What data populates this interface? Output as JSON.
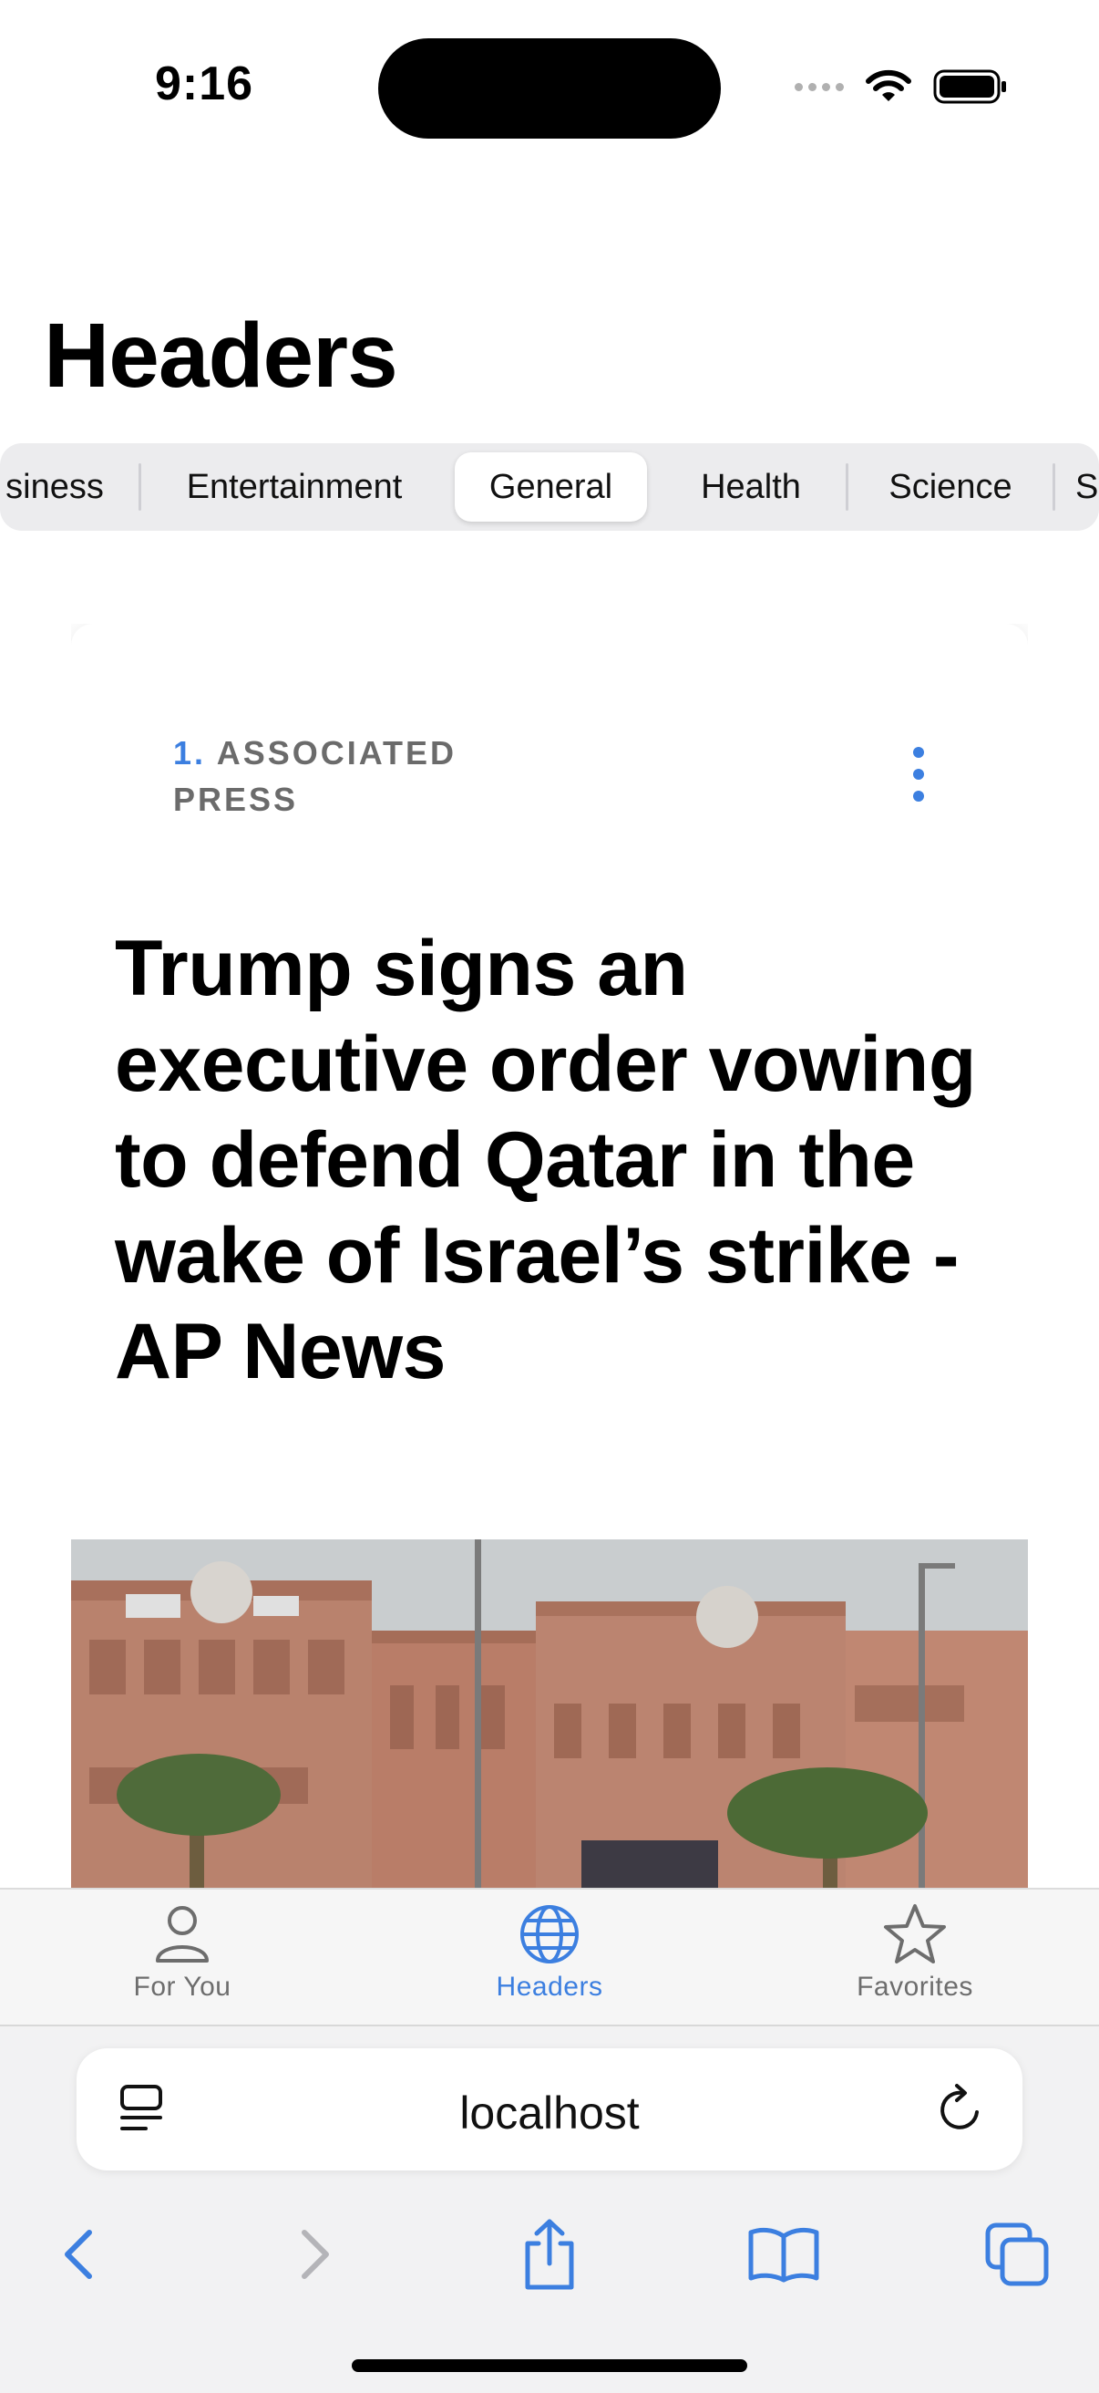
{
  "status_bar": {
    "time": "9:16"
  },
  "page_title": "Headers",
  "categories": [
    {
      "label": "siness",
      "active": false
    },
    {
      "label": "Entertainment",
      "active": false
    },
    {
      "label": "General",
      "active": true
    },
    {
      "label": "Health",
      "active": false
    },
    {
      "label": "Science",
      "active": false
    },
    {
      "label": "S",
      "active": false
    }
  ],
  "article": {
    "rank": "1.",
    "source_line1": "ASSOCIATED",
    "source_line2": "PRESS",
    "headline": "Trump signs an executive order vowing to defend Qatar in the wake of Israel’s strike - AP News"
  },
  "tab_bar": {
    "tabs": [
      {
        "label": "For You",
        "icon": "person-icon",
        "active": false
      },
      {
        "label": "Headers",
        "icon": "globe-icon",
        "active": true
      },
      {
        "label": "Favorites",
        "icon": "star-icon",
        "active": false
      }
    ]
  },
  "browser": {
    "url": "localhost"
  },
  "colors": {
    "accent": "#3c7fe0",
    "muted": "#6d6d6d",
    "segment_bg": "#ececee"
  }
}
